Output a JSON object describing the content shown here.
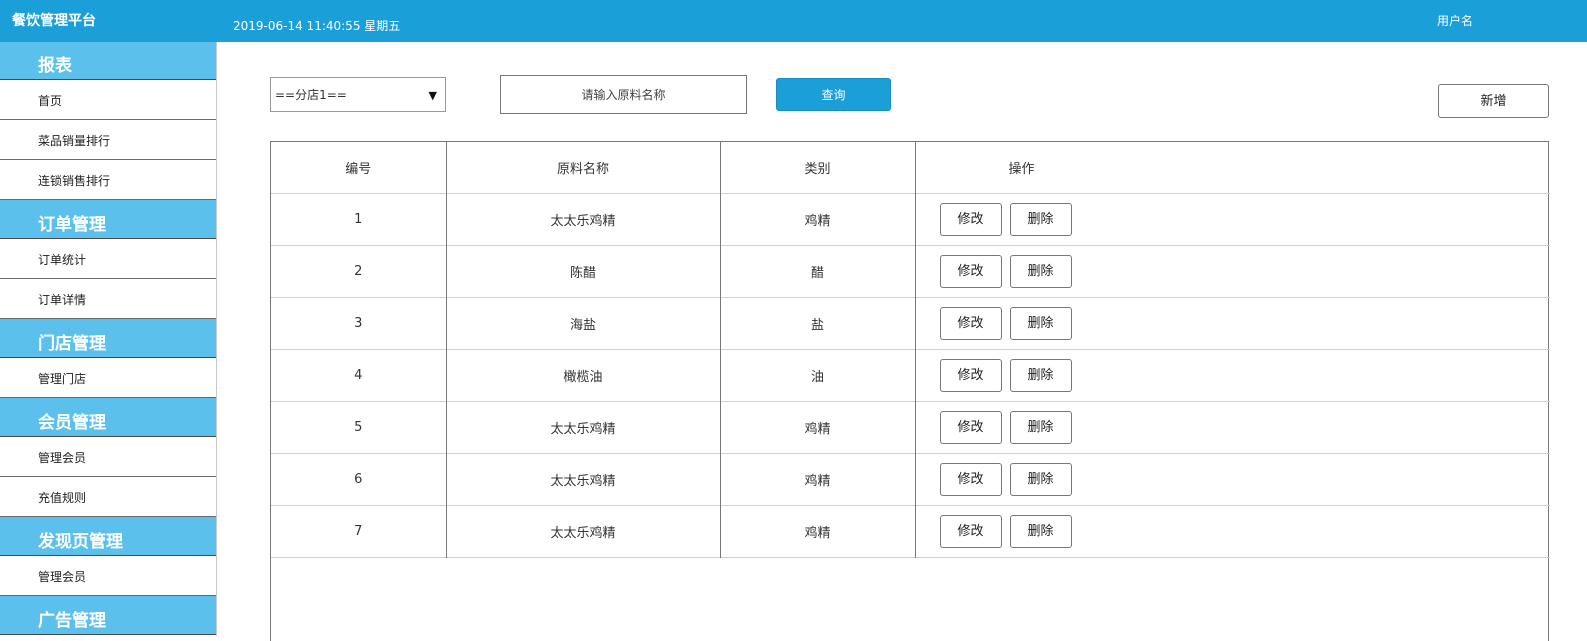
{
  "header": {
    "title": "餐饮管理平台",
    "datetime": "2019-06-14 11:40:55 星期五",
    "username": "用户名"
  },
  "sidebar": {
    "sections": [
      {
        "title": "报表",
        "items": [
          "首页",
          "菜品销量排行",
          "连锁销售排行"
        ]
      },
      {
        "title": "订单管理",
        "items": [
          "订单统计",
          "订单详情"
        ]
      },
      {
        "title": "门店管理",
        "items": [
          "管理门店"
        ]
      },
      {
        "title": "会员管理",
        "items": [
          "管理会员",
          "充值规则"
        ]
      },
      {
        "title": "发现页管理",
        "items": [
          "管理会员"
        ]
      },
      {
        "title": "广告管理",
        "items": []
      }
    ]
  },
  "toolbar": {
    "store_selected": "==分店1==",
    "search_placeholder": "请输入原料名称",
    "query_label": "查询",
    "add_label": "新增"
  },
  "table": {
    "headers": [
      "编号",
      "原料名称",
      "类别",
      "操作"
    ],
    "rows": [
      {
        "id": "1",
        "name": "太太乐鸡精",
        "category": "鸡精"
      },
      {
        "id": "2",
        "name": "陈醋",
        "category": "醋"
      },
      {
        "id": "3",
        "name": "海盐",
        "category": "盐"
      },
      {
        "id": "4",
        "name": "橄榄油",
        "category": "油"
      },
      {
        "id": "5",
        "name": "太太乐鸡精",
        "category": "鸡精"
      },
      {
        "id": "6",
        "name": "太太乐鸡精",
        "category": "鸡精"
      },
      {
        "id": "7",
        "name": "太太乐鸡精",
        "category": "鸡精"
      }
    ],
    "edit_label": "修改",
    "delete_label": "删除"
  },
  "colors": {
    "header_bg": "#1b9fd8",
    "section_bg": "#5bc0eb",
    "query_btn": "#1b9fd8"
  }
}
